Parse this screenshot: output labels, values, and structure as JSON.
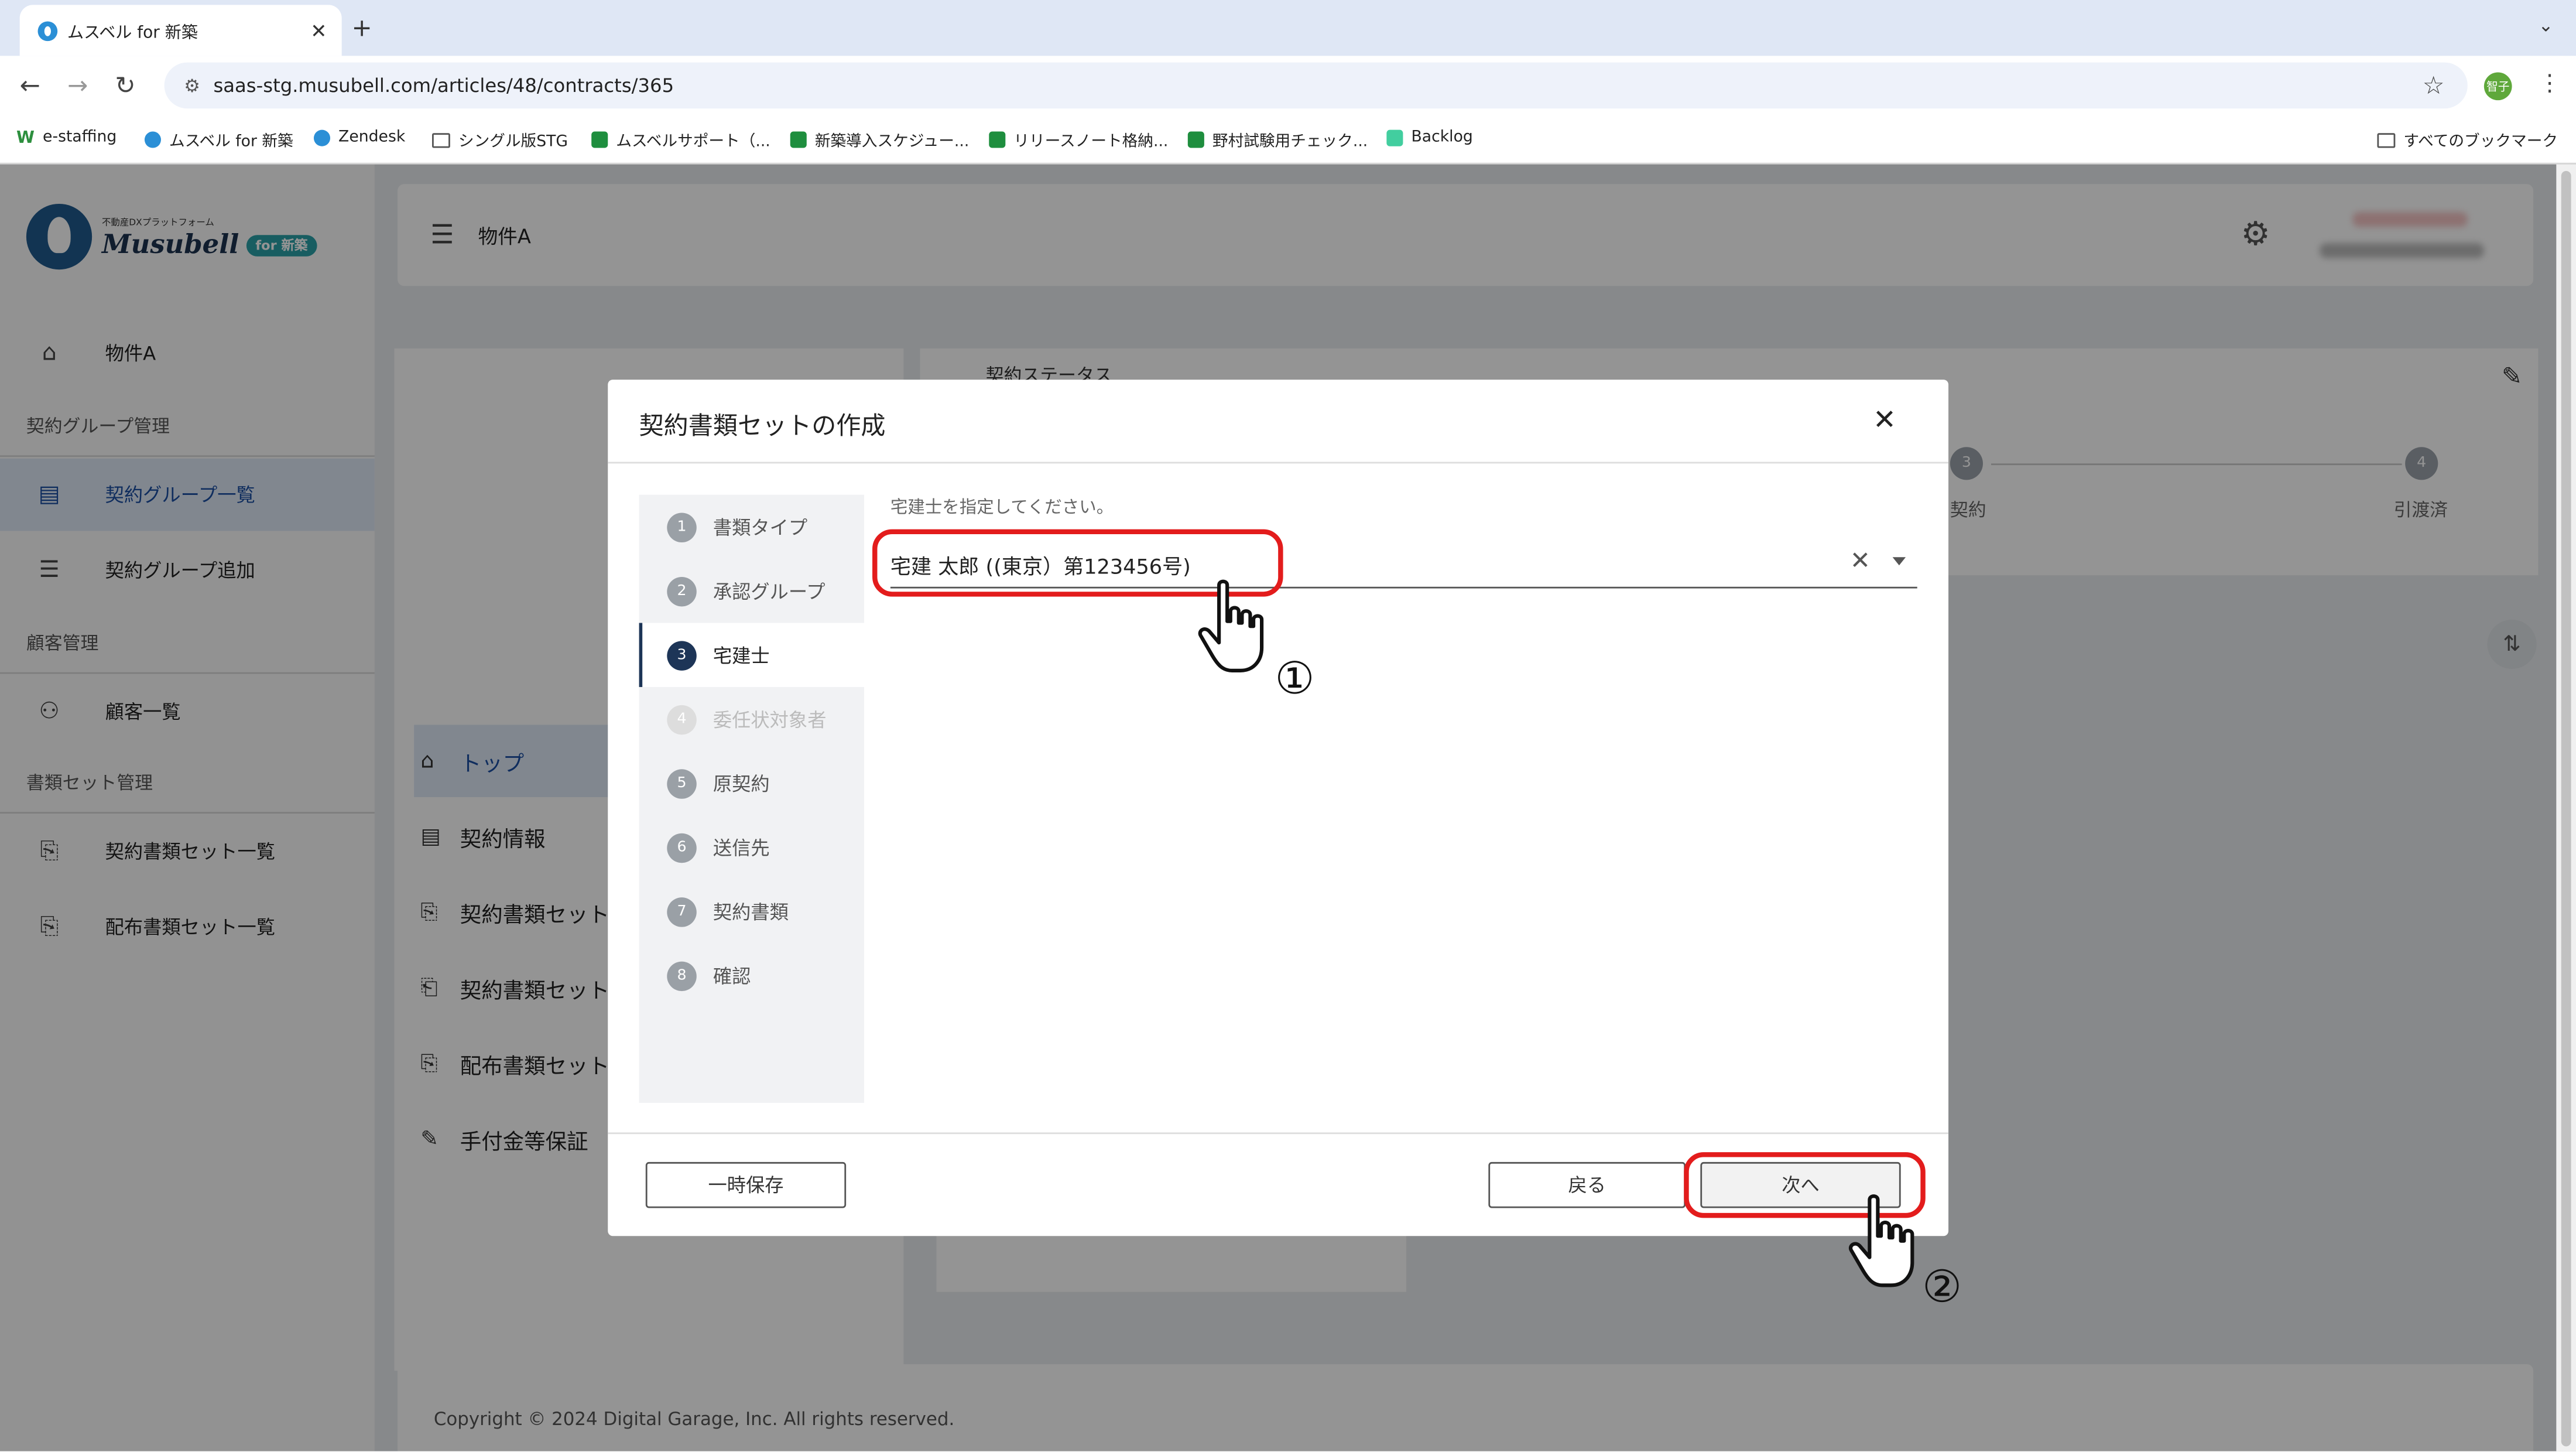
{
  "browser": {
    "tab_title": "ムスベル for 新築",
    "tab_close": "✕",
    "new_tab": "+",
    "tab_menu": "⌄",
    "url": "saas-stg.musubell.com/articles/48/contracts/365",
    "profile_text": "智子",
    "bookmarks": [
      {
        "label": "e-staffing",
        "icon": "e-staffing-icon"
      },
      {
        "label": "ムスベル for 新築",
        "icon": "musubell-icon"
      },
      {
        "label": "Zendesk",
        "icon": "zendesk-icon"
      },
      {
        "label": "シングル版STG",
        "icon": "folder-icon"
      },
      {
        "label": "ムスベルサポート（...",
        "icon": "sheets-icon"
      },
      {
        "label": "新築導入スケジュー...",
        "icon": "sheets-icon"
      },
      {
        "label": "リリースノート格納...",
        "icon": "sheets-icon"
      },
      {
        "label": "野村試験用チェック...",
        "icon": "sheets-icon"
      },
      {
        "label": "Backlog",
        "icon": "backlog-icon"
      }
    ],
    "all_bookmarks": "すべてのブックマーク"
  },
  "sidebar": {
    "logo_tagline": "不動産DXプラットフォーム",
    "logo_brand": "Musubell",
    "logo_badge": "for 新築",
    "property": "物件A",
    "section_contract_group": "契約グループ管理",
    "contract_group_list": "契約グループ一覧",
    "contract_group_add": "契約グループ追加",
    "section_customer": "顧客管理",
    "customer_list": "顧客一覧",
    "section_docset": "書類セット管理",
    "contract_docset_list": "契約書類セット一覧",
    "dist_docset_list": "配布書類セット一覧"
  },
  "header": {
    "title": "物件A"
  },
  "background": {
    "status_title": "契約ステータス",
    "step3_num": "3",
    "step3_label": "契約",
    "step4_num": "4",
    "step4_label": "引渡済",
    "nav": [
      {
        "label": "トップ",
        "icon": "home-icon"
      },
      {
        "label": "契約情報",
        "icon": "document-icon"
      },
      {
        "label": "契約書類セット",
        "icon": "doc-search-icon"
      },
      {
        "label": "契約書類セット",
        "icon": "doc-add-icon"
      },
      {
        "label": "配布書類セット",
        "icon": "doc-search-icon"
      },
      {
        "label": "手付金等保証",
        "icon": "doc-edit-icon"
      }
    ],
    "copyright": "Copyright © 2024 Digital Garage, Inc. All rights reserved."
  },
  "modal": {
    "title": "契約書類セットの作成",
    "close": "✕",
    "steps": [
      {
        "num": "1",
        "label": "書類タイプ",
        "state": "done"
      },
      {
        "num": "2",
        "label": "承認グループ",
        "state": "done"
      },
      {
        "num": "3",
        "label": "宅建士",
        "state": "current"
      },
      {
        "num": "4",
        "label": "委任状対象者",
        "state": "disabled"
      },
      {
        "num": "5",
        "label": "原契約",
        "state": "todo"
      },
      {
        "num": "6",
        "label": "送信先",
        "state": "todo"
      },
      {
        "num": "7",
        "label": "契約書類",
        "state": "todo"
      },
      {
        "num": "8",
        "label": "確認",
        "state": "todo"
      }
    ],
    "field_label": "宅建士を指定してください。",
    "field_value": "宅建 太郎 ((東京）第123456号)",
    "clear": "✕",
    "save_draft": "一時保存",
    "back": "戻る",
    "next": "次へ"
  },
  "annotations": {
    "marker1": "①",
    "marker2": "②",
    "highlight_color": "#e31c1c"
  },
  "colors": {
    "accent": "#1b4ea3",
    "step_current": "#1d3557",
    "brand_badge": "#2aa0a8"
  }
}
